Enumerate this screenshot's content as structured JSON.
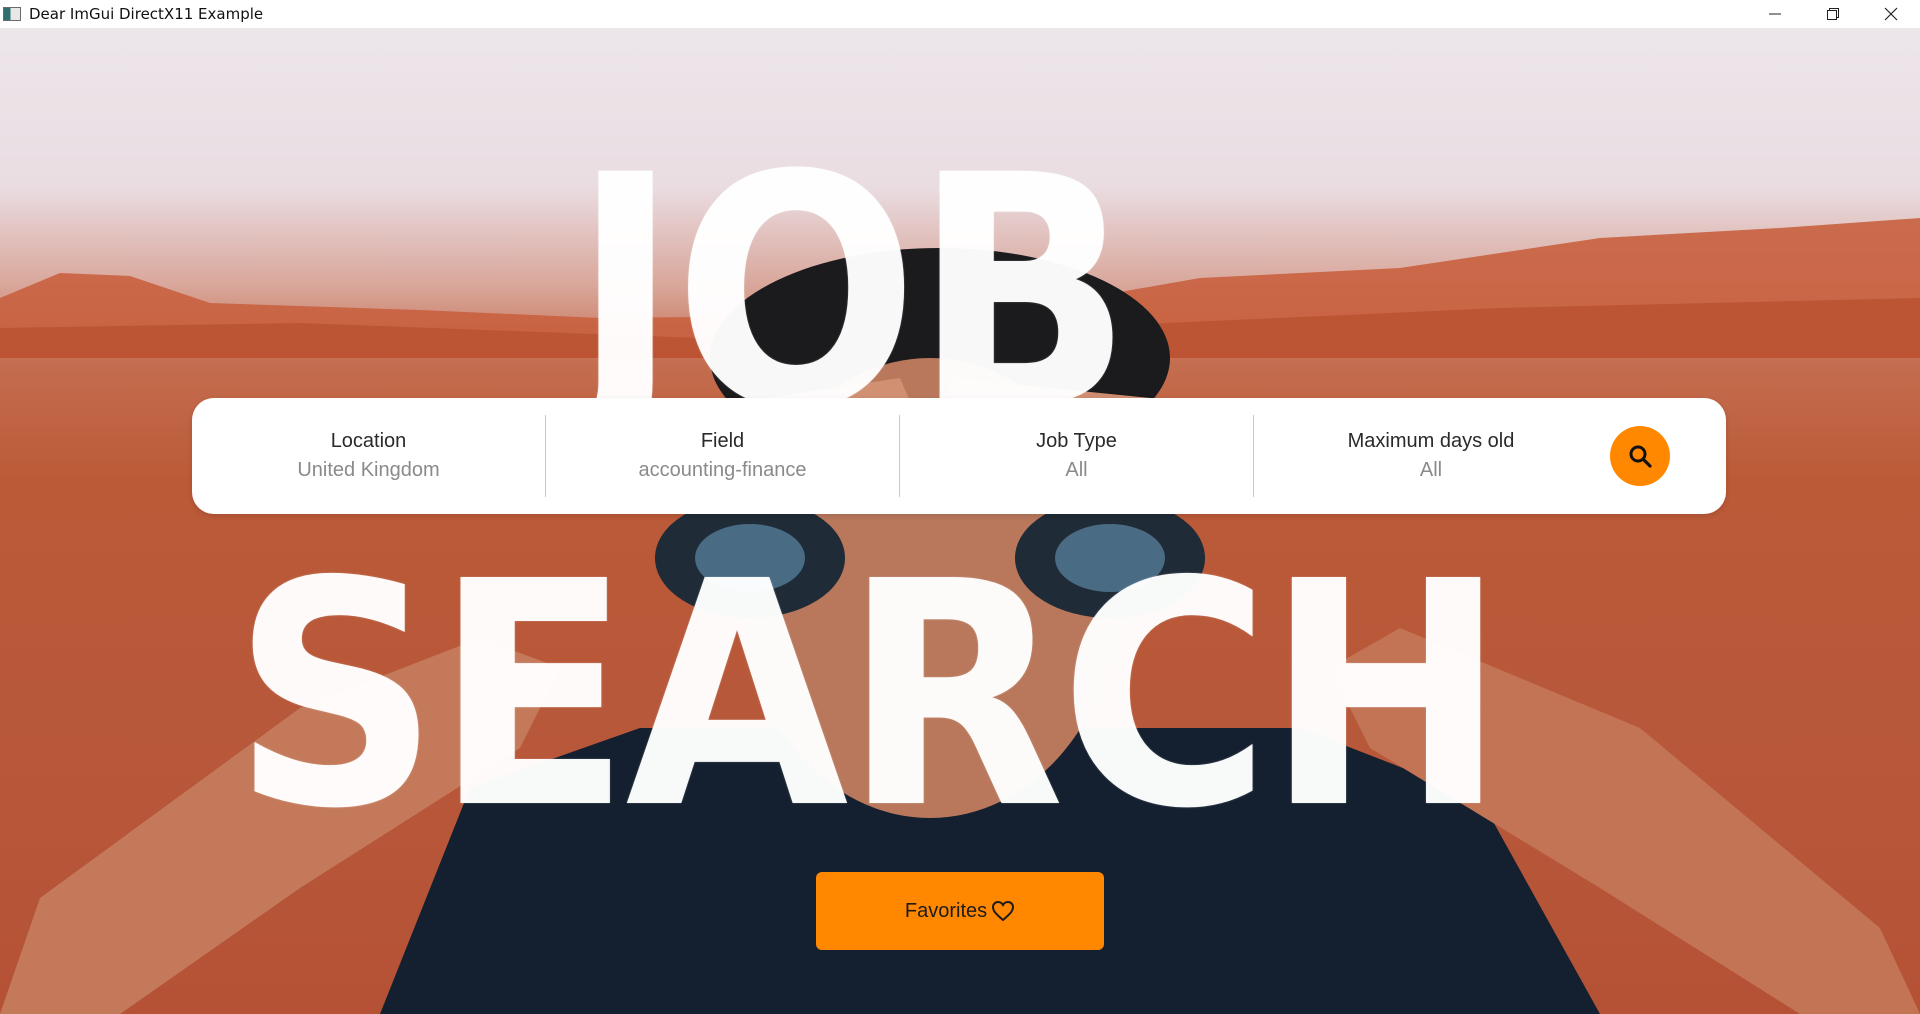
{
  "window": {
    "title": "Dear ImGui DirectX11 Example",
    "icons": [
      "app-icon",
      "minimize-icon",
      "restore-icon",
      "close-icon"
    ]
  },
  "hero": {
    "line1": "JOB",
    "line2": "SEARCH"
  },
  "search_panel": {
    "fields": [
      {
        "label": "Location",
        "value": "United Kingdom"
      },
      {
        "label": "Field",
        "value": "accounting-finance"
      },
      {
        "label": "Job Type",
        "value": "All"
      },
      {
        "label": "Maximum days old",
        "value": "All"
      }
    ],
    "search_icon": "search-icon",
    "accent_color": "#ff8800"
  },
  "favorites": {
    "label": "Favorites",
    "icon": "heart-icon",
    "color": "#ff8800"
  }
}
